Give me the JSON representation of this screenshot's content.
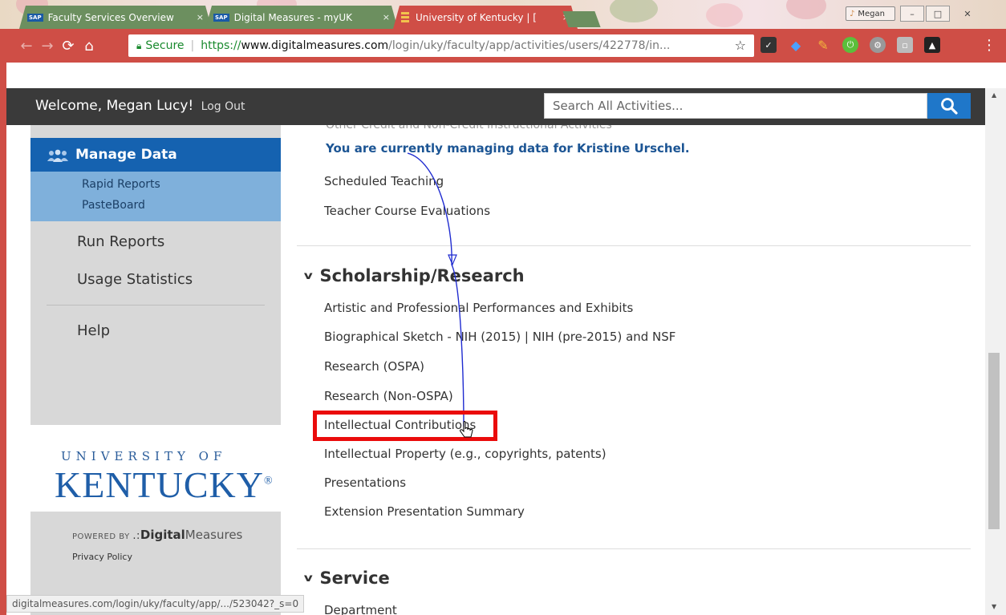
{
  "browser": {
    "tabs": [
      {
        "label": "Faculty Services Overview",
        "badge": "SAP",
        "active": false
      },
      {
        "label": "Digital Measures - myUK",
        "badge": "SAP",
        "active": false
      },
      {
        "label": "University of Kentucky | [",
        "badge": "",
        "active": true
      }
    ],
    "tab_close": "×",
    "user_chip": "Megan",
    "window_buttons": {
      "minimize": "–",
      "maximize": "□",
      "close": "✕"
    },
    "omnibox": {
      "secure_label": "Secure",
      "protocol": "https://",
      "host": "www.digitalmeasures.com",
      "path": "/login/uky/faculty/app/activities/users/422778/in..."
    },
    "status_url": "digitalmeasures.com/login/uky/faculty/app/.../523042?_s=0"
  },
  "header": {
    "welcome": "Welcome, Megan Lucy!",
    "logout": "Log Out",
    "search_placeholder": "Search All Activities..."
  },
  "sidebar": {
    "manage_data": "Manage Data",
    "sub_items": [
      "Rapid Reports",
      "PasteBoard"
    ],
    "run_reports": "Run Reports",
    "usage_statistics": "Usage Statistics",
    "help": "Help",
    "logo_small": "UNIVERSITY OF",
    "logo_big": "KENTUCKY",
    "powered_by": "POWERED BY",
    "dm_bold": "Digital",
    "dm_light": "Measures",
    "privacy": "Privacy Policy"
  },
  "main": {
    "cut_off_text": "Other Credit and Non-Credit Instructional Activities",
    "notice": "You are currently managing data for Kristine Urschel.",
    "teaching_items": [
      "Scheduled Teaching",
      "Teacher Course Evaluations"
    ],
    "scholarship_title": "Scholarship/Research",
    "scholarship_items": [
      "Artistic and Professional Performances and Exhibits",
      "Biographical Sketch - NIH (2015) | NIH (pre-2015) and NSF",
      "Research (OSPA)",
      "Research (Non-OSPA)",
      "Intellectual Contributions",
      "Intellectual Property (e.g., copyrights, patents)",
      "Presentations",
      "Extension Presentation Summary"
    ],
    "service_title": "Service",
    "service_items": [
      "Department"
    ]
  },
  "colors": {
    "chrome_accent": "#cf4e46",
    "nav_dark": "#3a3a3a",
    "uk_blue": "#1562b0",
    "highlight": "#ea0b0b"
  }
}
